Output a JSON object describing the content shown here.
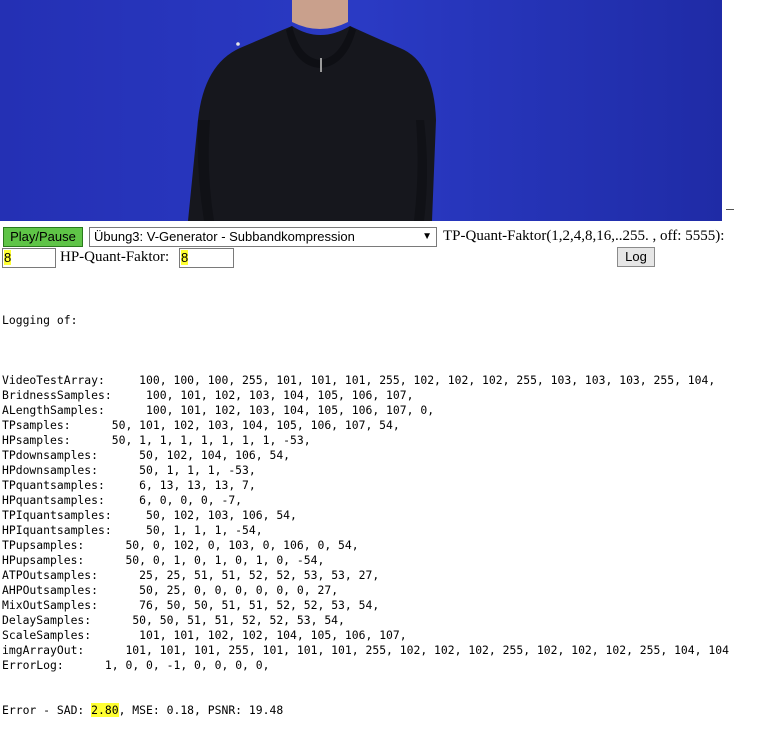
{
  "controls": {
    "play_pause_label": "Play/Pause",
    "mode_selected": "Übung3: V-Generator - Subbandkompression",
    "tp_quant_label": "TP-Quant-Faktor(1,2,4,8,16,..255. , off: 5555):",
    "tp_quant_value": "8",
    "hp_quant_label": "HP-Quant-Faktor:",
    "hp_quant_value": "8",
    "log_button_label": "Log"
  },
  "log": {
    "header": "Logging of:",
    "rows": [
      {
        "name": "VideoTestArray:",
        "values": "100, 100, 100, 255, 101, 101, 101, 255, 102, 102, 102, 255, 103, 103, 103, 255, 104,"
      },
      {
        "name": "BridnessSamples:",
        "values": "100, 101, 102, 103, 104, 105, 106, 107,"
      },
      {
        "name": "ALengthSamples:",
        "values": "100, 101, 102, 103, 104, 105, 106, 107, 0,"
      },
      {
        "name": "TPsamples:",
        "values": "50, 101, 102, 103, 104, 105, 106, 107, 54,"
      },
      {
        "name": "HPsamples:",
        "values": "50, 1, 1, 1, 1, 1, 1, 1, -53,"
      },
      {
        "name": "TPdownsamples:",
        "values": "50, 102, 104, 106, 54,"
      },
      {
        "name": "HPdownsamples:",
        "values": "50, 1, 1, 1, -53,"
      },
      {
        "name": "TPquantsamples:",
        "values": "6, 13, 13, 13, 7,"
      },
      {
        "name": "HPquantsamples:",
        "values": "6, 0, 0, 0, -7,"
      },
      {
        "name": "TPIquantsamples:",
        "values": "50, 102, 103, 106, 54,"
      },
      {
        "name": "HPIquantsamples:",
        "values": "50, 1, 1, 1, -54,"
      },
      {
        "name": "TPupsamples:",
        "values": "50, 0, 102, 0, 103, 0, 106, 0, 54,"
      },
      {
        "name": "HPupsamples:",
        "values": "50, 0, 1, 0, 1, 0, 1, 0, -54,"
      },
      {
        "name": "ATPOutsamples:",
        "values": "25, 25, 51, 51, 52, 52, 53, 53, 27,"
      },
      {
        "name": "AHPOutsamples:",
        "values": "50, 25, 0, 0, 0, 0, 0, 0, 27,"
      },
      {
        "name": "MixOutSamples:",
        "values": "76, 50, 50, 51, 51, 52, 52, 53, 54,"
      },
      {
        "name": "DelaySamples:",
        "values": "50, 50, 51, 51, 52, 52, 53, 54,"
      },
      {
        "name": "ScaleSamples:",
        "values": "101, 101, 102, 102, 104, 105, 106, 107,"
      },
      {
        "name": "imgArrayOut:",
        "values": "101, 101, 101, 255, 101, 101, 101, 255, 102, 102, 102, 255, 102, 102, 102, 255, 104, 104"
      },
      {
        "name": "ErrorLog:",
        "values": "1, 0, 0, -1, 0, 0, 0, 0,"
      }
    ],
    "error_prefix": "Error - SAD: ",
    "sad_value": "2.80",
    "error_suffix": ", MSE: 0.18, PSNR: 19.48"
  },
  "colors": {
    "video_background": "#2332b9",
    "play_button": "#5fc447",
    "highlight": "#ffff33"
  }
}
